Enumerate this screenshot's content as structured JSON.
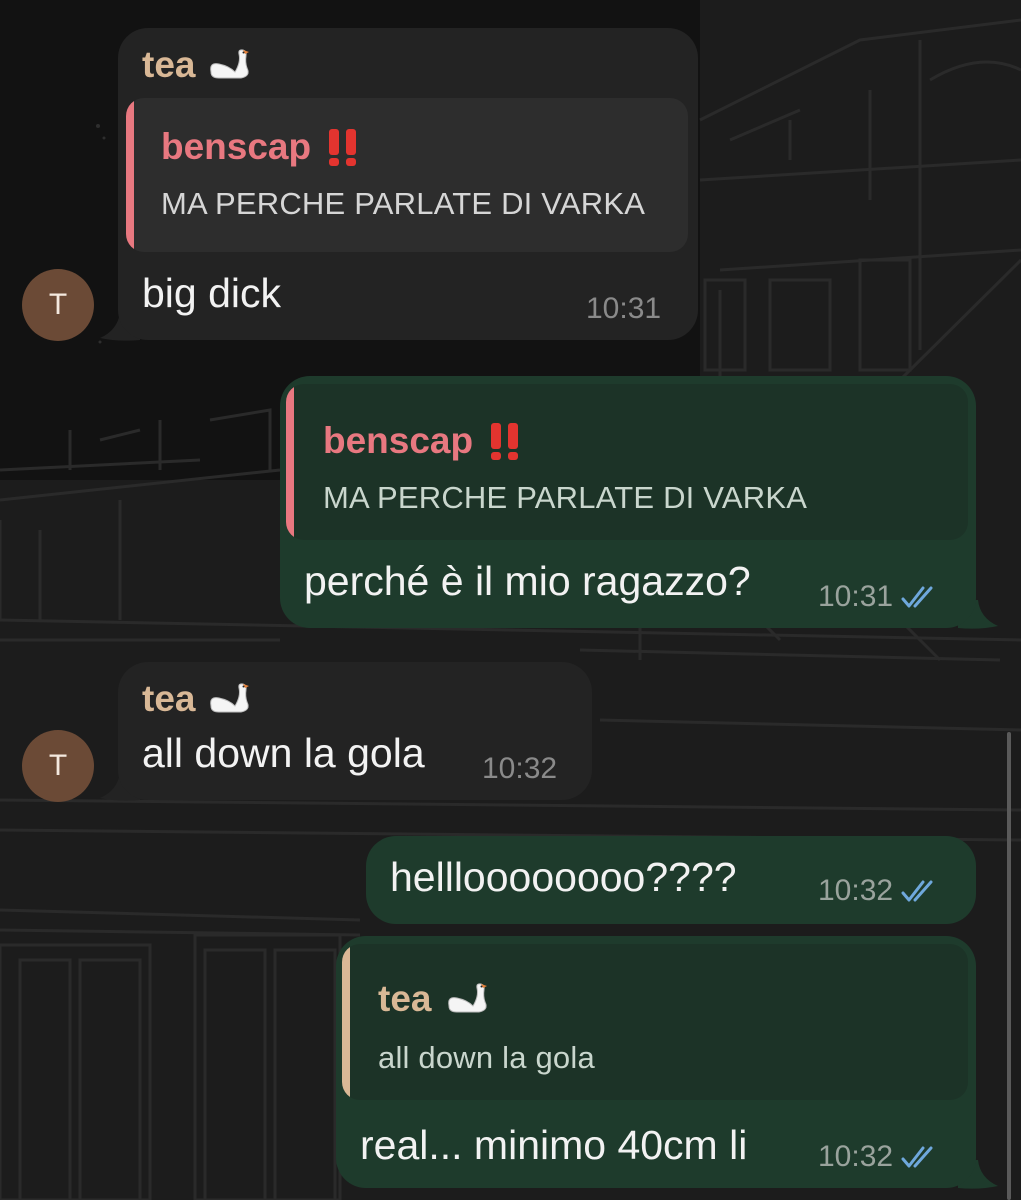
{
  "colors": {
    "incoming_bubble": "#232323",
    "outgoing_bubble": "#1e3b2c",
    "sender_name": "#d9b896",
    "reply_name_benscap": "#e87880",
    "reply_bar_benscap": "#e87880",
    "reply_bar_tea": "#d9b896",
    "exclaim": "#e3342f",
    "read_check": "#6fa8dc",
    "avatar": "#6b4a36"
  },
  "messages": [
    {
      "id": "m1",
      "direction": "incoming",
      "sender": "tea",
      "sender_icon": "swan-icon",
      "reply": {
        "name": "benscap",
        "name_icon": "double-exclamation-icon",
        "text": "MA PERCHE PARLATE DI VARKA"
      },
      "text": "big dick",
      "time": "10:31",
      "avatar_letter": "T"
    },
    {
      "id": "m2",
      "direction": "outgoing",
      "reply": {
        "name": "benscap",
        "name_icon": "double-exclamation-icon",
        "text": "MA PERCHE PARLATE DI VARKA"
      },
      "text": "perché è il mio ragazzo?",
      "time": "10:31",
      "status_icon": "double-check-icon"
    },
    {
      "id": "m3",
      "direction": "incoming",
      "sender": "tea",
      "sender_icon": "swan-icon",
      "text": "all down la gola",
      "time": "10:32",
      "avatar_letter": "T"
    },
    {
      "id": "m4",
      "direction": "outgoing",
      "text": "hellloooooooo????",
      "time": "10:32",
      "status_icon": "double-check-icon"
    },
    {
      "id": "m5",
      "direction": "outgoing",
      "reply": {
        "name": "tea",
        "name_icon": "swan-icon",
        "text": "all down la gola"
      },
      "text": "real... minimo 40cm li",
      "time": "10:32",
      "status_icon": "double-check-icon"
    }
  ]
}
